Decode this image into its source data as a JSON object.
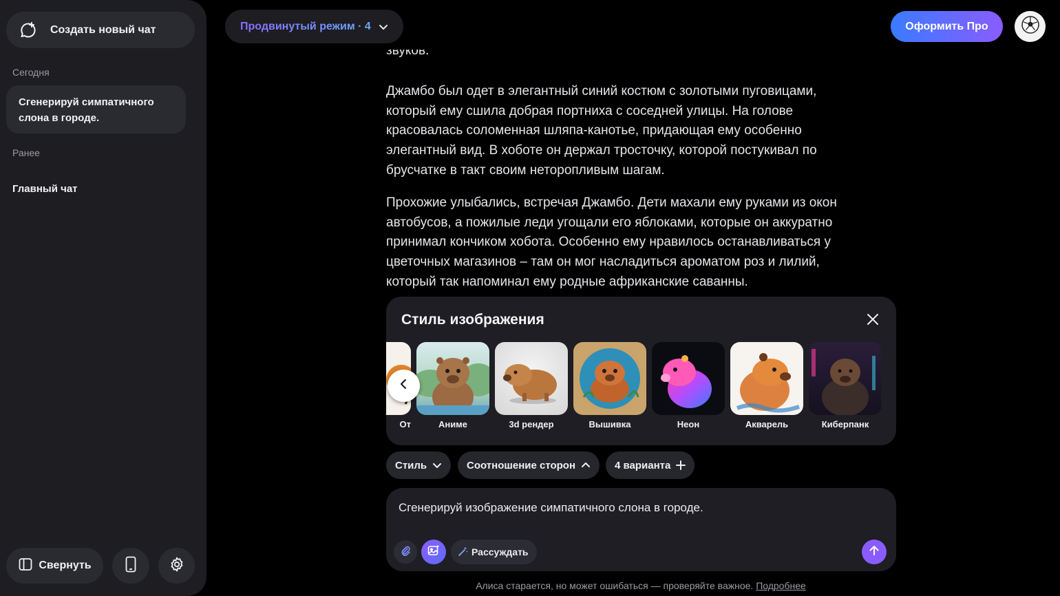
{
  "sidebar": {
    "new_chat_label": "Создать новый чат",
    "today_label": "Сегодня",
    "active_chat": "Сгенерируй симпатичного слона в городе.",
    "earlier_label": "Ранее",
    "main_chat": "Главный чат",
    "collapse_label": "Свернуть"
  },
  "header": {
    "mode_label": "Продвинутый режим · 4",
    "pro_label": "Оформить Про"
  },
  "message": {
    "top_fragment": "звуков.",
    "paragraph1": "Джамбо был одет в элегантный синий костюм с золотыми пуговицами, который ему сшила добрая портниха с соседней улицы. На голове красовалась соломенная шляпа-канотье, придающая ему особенно элегантный вид. В хоботе он держал тросточку, которой постукивал по брусчатке в такт своим неторопливым шагам.",
    "paragraph2": "Прохожие улыбались, встречая Джамбо. Дети махали ему руками из окон автобусов, а пожилые леди угощали его яблоками, которые он аккуратно принимал кончиком хобота. Особенно ему нравилось останавливаться у цветочных магазинов – там он мог насладиться ароматом роз и лилий, который так напоминал ему родные африканские саванны."
  },
  "style_panel": {
    "title": "Стиль изображения",
    "styles": [
      {
        "label": "От"
      },
      {
        "label": "Аниме"
      },
      {
        "label": "3d рендер"
      },
      {
        "label": "Вышивка"
      },
      {
        "label": "Неон"
      },
      {
        "label": "Акварель"
      },
      {
        "label": "Киберпанк"
      }
    ]
  },
  "chips": {
    "style": "Стиль",
    "aspect": "Соотношение сторон",
    "variants": "4 варианта"
  },
  "input": {
    "text": "Сгенерируй изображение симпатичного слона в городе.",
    "think_label": "Рассуждать"
  },
  "footer": {
    "text": "Алиса старается, но может ошибаться — проверяйте важное.",
    "link": "Подробнее"
  },
  "colors": {
    "accent": "#8a5cff",
    "pro_gradient_start": "#3a7bff",
    "pro_gradient_end": "#8a5cff"
  }
}
